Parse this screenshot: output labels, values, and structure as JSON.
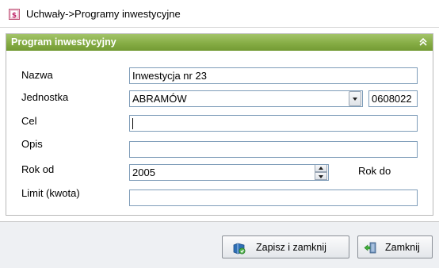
{
  "window": {
    "title": "Uchwały->Programy inwestycyjne",
    "icon": "document-dollar-icon"
  },
  "panel": {
    "title": "Program inwestycyjny",
    "collapse_icon": "double-chevron-up-icon",
    "accent_color": "#86ad45"
  },
  "form": {
    "nazwa": {
      "label": "Nazwa",
      "value": "Inwestycja nr 23"
    },
    "jednostka": {
      "label": "Jednostka",
      "value": "ABRAMÓW",
      "code": "0608022"
    },
    "cel": {
      "label": "Cel",
      "value": ""
    },
    "opis": {
      "label": "Opis",
      "value": ""
    },
    "rok_od": {
      "label": "Rok od",
      "value": "2005"
    },
    "rok_do": {
      "label": "Rok do"
    },
    "limit": {
      "label": "Limit (kwota)",
      "value": ""
    }
  },
  "buttons": {
    "save": {
      "label": "Zapisz i zamknij",
      "icon": "save-icon"
    },
    "close": {
      "label": "Zamknij",
      "icon": "exit-door-icon"
    }
  }
}
